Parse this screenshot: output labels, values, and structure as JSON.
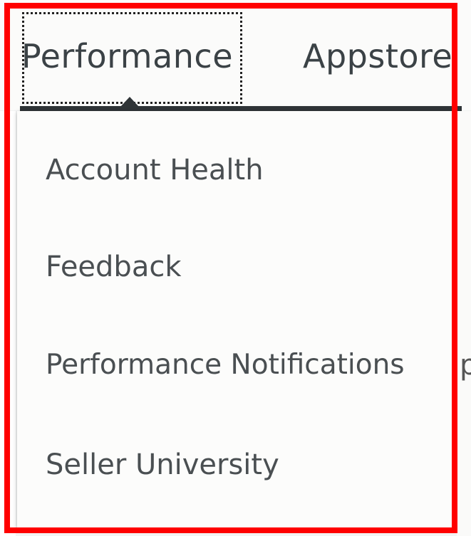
{
  "nav": {
    "tabs": [
      {
        "label": "Performance",
        "active": true
      },
      {
        "label": "Appstore",
        "active": false
      }
    ]
  },
  "dropdown": {
    "items": [
      {
        "label": "Account Health"
      },
      {
        "label": "Feedback"
      },
      {
        "label": "Performance Notifications"
      },
      {
        "label": "Seller University"
      }
    ]
  },
  "edge_fragment": "pi",
  "colors": {
    "highlight": "#ff0000",
    "underline": "#2f3437",
    "text": "#3b4246"
  }
}
